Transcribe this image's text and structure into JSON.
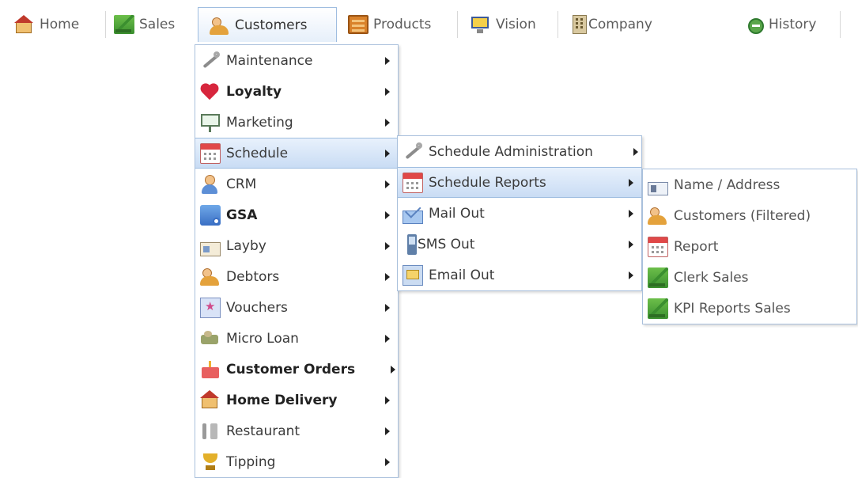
{
  "nav": {
    "items": [
      {
        "label": "Home",
        "icon": "home-icon"
      },
      {
        "label": "Sales",
        "icon": "chart-icon"
      },
      {
        "label": "Customers",
        "icon": "customers-icon",
        "active": true
      },
      {
        "label": "Products",
        "icon": "box-icon"
      },
      {
        "label": "Vision",
        "icon": "monitor-icon"
      },
      {
        "label": "Company",
        "icon": "building-icon"
      },
      {
        "label": "History",
        "icon": "history-icon"
      }
    ]
  },
  "menu1": {
    "items": [
      {
        "label": "Maintenance",
        "icon": "wrench-icon"
      },
      {
        "label": "Loyalty",
        "icon": "heart-icon"
      },
      {
        "label": "Marketing",
        "icon": "board-icon"
      },
      {
        "label": "Schedule",
        "icon": "calendar-icon"
      },
      {
        "label": "CRM",
        "icon": "user-icon"
      },
      {
        "label": "GSA",
        "icon": "gsa-icon"
      },
      {
        "label": "Layby",
        "icon": "card-icon"
      },
      {
        "label": "Debtors",
        "icon": "debtors-icon"
      },
      {
        "label": "Vouchers",
        "icon": "voucher-icon"
      },
      {
        "label": "Micro Loan",
        "icon": "loan-icon"
      },
      {
        "label": "Customer Orders",
        "icon": "cake-icon"
      },
      {
        "label": "Home Delivery",
        "icon": "home-delivery-icon"
      },
      {
        "label": "Restaurant",
        "icon": "fork-icon"
      },
      {
        "label": "Tipping",
        "icon": "trophy-icon"
      }
    ]
  },
  "menu2": {
    "items": [
      {
        "label": "Schedule Administration",
        "icon": "wrench-icon"
      },
      {
        "label": "Schedule Reports",
        "icon": "calendar-icon"
      },
      {
        "label": "Mail Out",
        "icon": "mail-icon"
      },
      {
        "label": "SMS Out",
        "icon": "phone-icon"
      },
      {
        "label": "Email Out",
        "icon": "email-icon"
      }
    ]
  },
  "menu3": {
    "items": [
      {
        "label": "Name / Address",
        "icon": "id-card-icon"
      },
      {
        "label": "Customers (Filtered)",
        "icon": "customers-icon"
      },
      {
        "label": "Report",
        "icon": "calendar-icon"
      },
      {
        "label": "Clerk Sales",
        "icon": "chart-icon"
      },
      {
        "label": "KPI Reports Sales",
        "icon": "chart-icon"
      }
    ]
  },
  "colors": {
    "highlight_border": "#9fbde0",
    "highlight_bg": "#c9dcf4",
    "menu_border": "#a9c0dc"
  }
}
